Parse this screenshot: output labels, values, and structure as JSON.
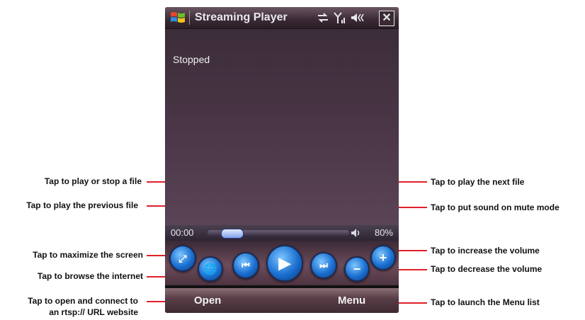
{
  "app": {
    "title": "Streaming Player",
    "status": "Stopped"
  },
  "seek": {
    "time": "00:00",
    "position": 0.05
  },
  "volume": {
    "level": "80%"
  },
  "softkeys": {
    "left": "Open",
    "right": "Menu"
  },
  "annotations": {
    "play_stop": "Tap to play or stop a file",
    "previous": "Tap to play the previous file",
    "maximize": "Tap to maximize the screen",
    "browse": "Tap to browse the internet",
    "open_line1": "Tap to open and  connect to",
    "open_line2": "an rtsp:// URL website",
    "next": "Tap to play the next file",
    "mute": "Tap to put sound on mute mode",
    "vol_up": "Tap to increase the volume",
    "vol_down": "Tap to decrease the volume",
    "menu": "Tap to launch the Menu list"
  },
  "colors": {
    "callout_line": "#e0202a",
    "button_blue": "#1a6fd0"
  }
}
